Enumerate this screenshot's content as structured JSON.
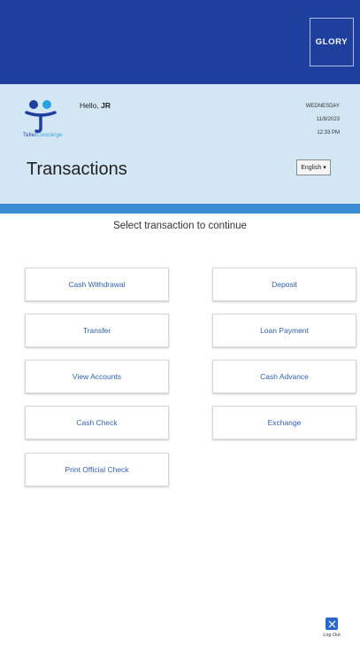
{
  "brand": {
    "name": "GLORY"
  },
  "header": {
    "logo_text_primary": "Teller",
    "logo_text_accent": "Concierge",
    "greeting_prefix": "Hello, ",
    "user_name": "JR",
    "day": "WEDNESDAY",
    "date": "11/8/2023",
    "time": "12:33 PM",
    "title": "Transactions",
    "language": "English",
    "language_caret": "▾"
  },
  "main": {
    "subtitle": "Select transaction to continue",
    "buttons": [
      {
        "label": "Cash Withdrawal"
      },
      {
        "label": "Deposit"
      },
      {
        "label": "Transfer"
      },
      {
        "label": "Loan Payment"
      },
      {
        "label": "View Accounts"
      },
      {
        "label": "Cash Advance"
      },
      {
        "label": "Cash Check"
      },
      {
        "label": "Exchange"
      },
      {
        "label": "Print Official Check"
      }
    ]
  },
  "footer": {
    "logout_label": "Log Out"
  },
  "colors": {
    "header_blue": "#1e3f9d",
    "info_panel": "#d3e6f4",
    "stripe": "#3a8bd1",
    "button_text": "#2f5faf",
    "logout": "#2b66cc"
  },
  "icons": {
    "logo": "teller-concierge-logo-icon",
    "logout": "close-icon"
  }
}
